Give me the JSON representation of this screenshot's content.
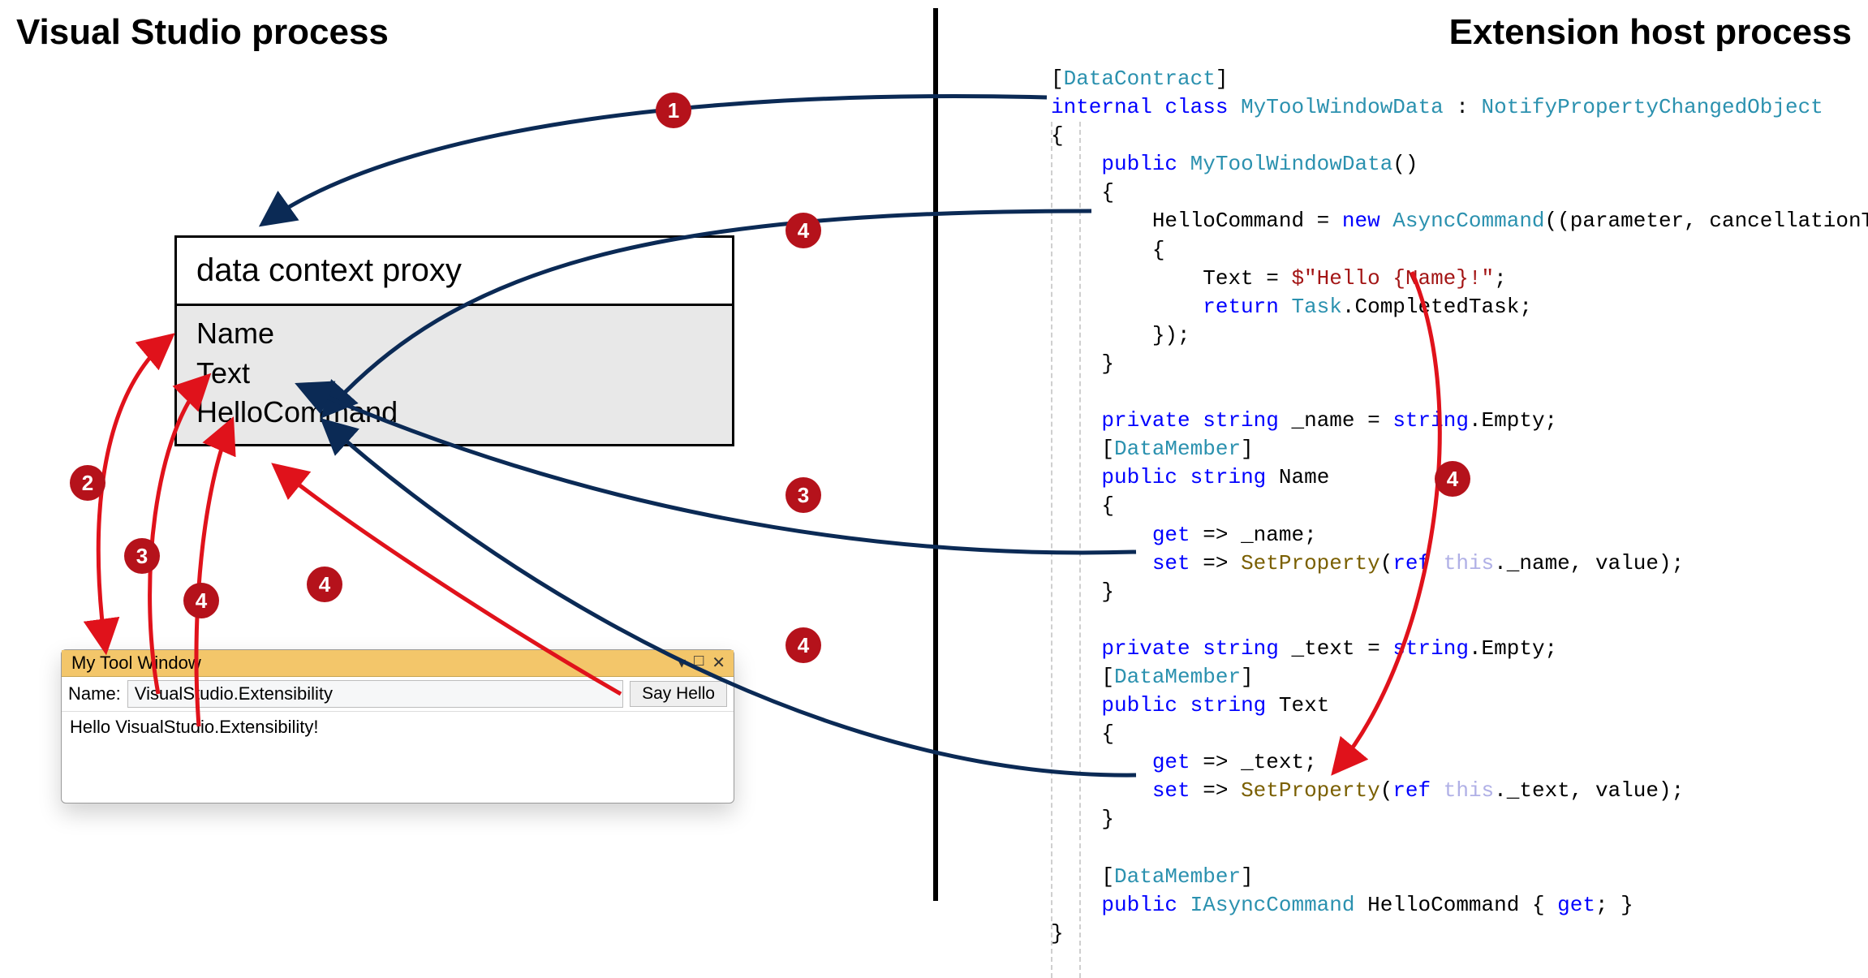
{
  "headers": {
    "left": "Visual Studio process",
    "right": "Extension host process"
  },
  "proxy": {
    "title": "data context proxy",
    "fields": [
      "Name",
      "Text",
      "HelloCommand"
    ]
  },
  "toolwindow": {
    "title": "My Tool Window",
    "name_label": "Name:",
    "name_value": "VisualStudio.Extensibility",
    "button": "Say Hello",
    "output": "Hello VisualStudio.Extensibility!"
  },
  "code": {
    "attr1": "DataContract",
    "class_decl_kw1": "internal",
    "class_decl_kw2": "class",
    "class_name": "MyToolWindowData",
    "base_class": "NotifyPropertyChangedObject",
    "ctor_kw": "public",
    "ctor_name": "MyToolWindowData",
    "hello_assign": "HelloCommand = ",
    "new_kw": "new",
    "async_cmd": "AsyncCommand",
    "lambda_params": "((parameter, cancellationToken) =>",
    "text_assign_pre": "Text = ",
    "text_assign_str": "$\"Hello {Name}!\"",
    "text_assign_post": ";",
    "return_kw": "return",
    "task_type": "Task",
    "completed": ".CompletedTask;",
    "lambda_close": "});",
    "private_kw": "private",
    "string_kw": "string",
    "name_field": "_name = ",
    "string_type": "string",
    "empty": ".Empty;",
    "datamember": "DataMember",
    "public_kw": "public",
    "prop_name": "Name",
    "get_kw": "get",
    "arrow": " => ",
    "name_ret": "_name;",
    "set_kw": "set",
    "setprop": "SetProperty",
    "ref_kw": "ref",
    "this_kw": "this",
    "name_path": "._name, value);",
    "text_field": "_text = ",
    "prop_text": "Text",
    "text_ret": "_text;",
    "text_path": "._text, value);",
    "iasync": "IAsyncCommand",
    "hellocmd_prop": "HelloCommand { ",
    "hellocmd_get": "get",
    "hellocmd_end": "; }"
  },
  "badges": [
    "1",
    "2",
    "3",
    "4"
  ]
}
